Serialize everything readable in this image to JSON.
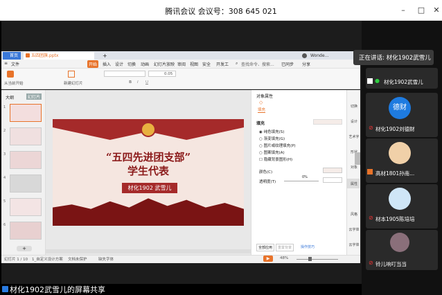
{
  "meeting": {
    "title": "腾讯会议 会议号：308 645 021",
    "minimize": "–",
    "maximize": "□",
    "close": "✕"
  },
  "wps": {
    "tabs": [
      {
        "label": "首页"
      },
      {
        "label": "五四团旗.pptx"
      },
      {
        "label": "+"
      }
    ],
    "user_name": "Wonde...",
    "menu": [
      "文件",
      "开始",
      "插入",
      "设计",
      "切换",
      "动画",
      "幻灯片放映",
      "审阅",
      "视图",
      "安全",
      "开发工"
    ],
    "search": "查找命令、搜索...",
    "sync": "已同步",
    "share": "分享",
    "ribbon": {
      "from_start": "从当前开始",
      "new_slide": "新建幻灯片",
      "font_size": "0.05"
    },
    "thumb_panel": {
      "tab1": "大纲",
      "tab2": "幻灯片",
      "numbers": [
        "1",
        "2",
        "3",
        "4",
        "5",
        "6"
      ]
    },
    "slide": {
      "title1": "“五四先进团支部”",
      "title2": "学生代表",
      "presenter": "材化1902  武雪儿"
    },
    "obj_panel": {
      "header": "对象属性",
      "tab": "填充",
      "section": "填充",
      "options": [
        "纯色填充(S)",
        "渐变填充(G)",
        "图片或纹理填充(P)",
        "图案填充(A)",
        "隐藏背景图形(H)"
      ],
      "color_label": "颜色(C)",
      "transparency_label": "透明度(T)",
      "transparency_value": "0%",
      "apply_all": "全部应用",
      "reset_bg": "重置背景",
      "tips": "操作技巧"
    },
    "right_tools": [
      "切换",
      "设计",
      "艺术字",
      "形状",
      "对象",
      "属性",
      "风格",
      "云字体",
      "云字体"
    ],
    "status": {
      "page": "幻灯片 1 / 10",
      "theme": "1_自定义设计方案",
      "protect": "文档未保护",
      "font": "缺失字体",
      "zoom": "48%"
    }
  },
  "sharing_label": "材化1902武雪儿的屏幕共享",
  "participants": {
    "speaking": "正在讲话: 材化1902武雪儿",
    "list": [
      {
        "name": "材化1902武雪儿",
        "avatar_text": ""
      },
      {
        "name": "材化1902刘德财",
        "avatar_text": "德财"
      },
      {
        "name": "高材1801孙南...",
        "avatar_text": ""
      },
      {
        "name": "材本1905陈培培",
        "avatar_text": ""
      },
      {
        "name": "铃儿响叮当当",
        "avatar_text": ""
      }
    ]
  },
  "colors": {
    "accent": "#e8732a",
    "slide_red": "#a52a2a",
    "avatar_blue": "#1e7be0"
  }
}
